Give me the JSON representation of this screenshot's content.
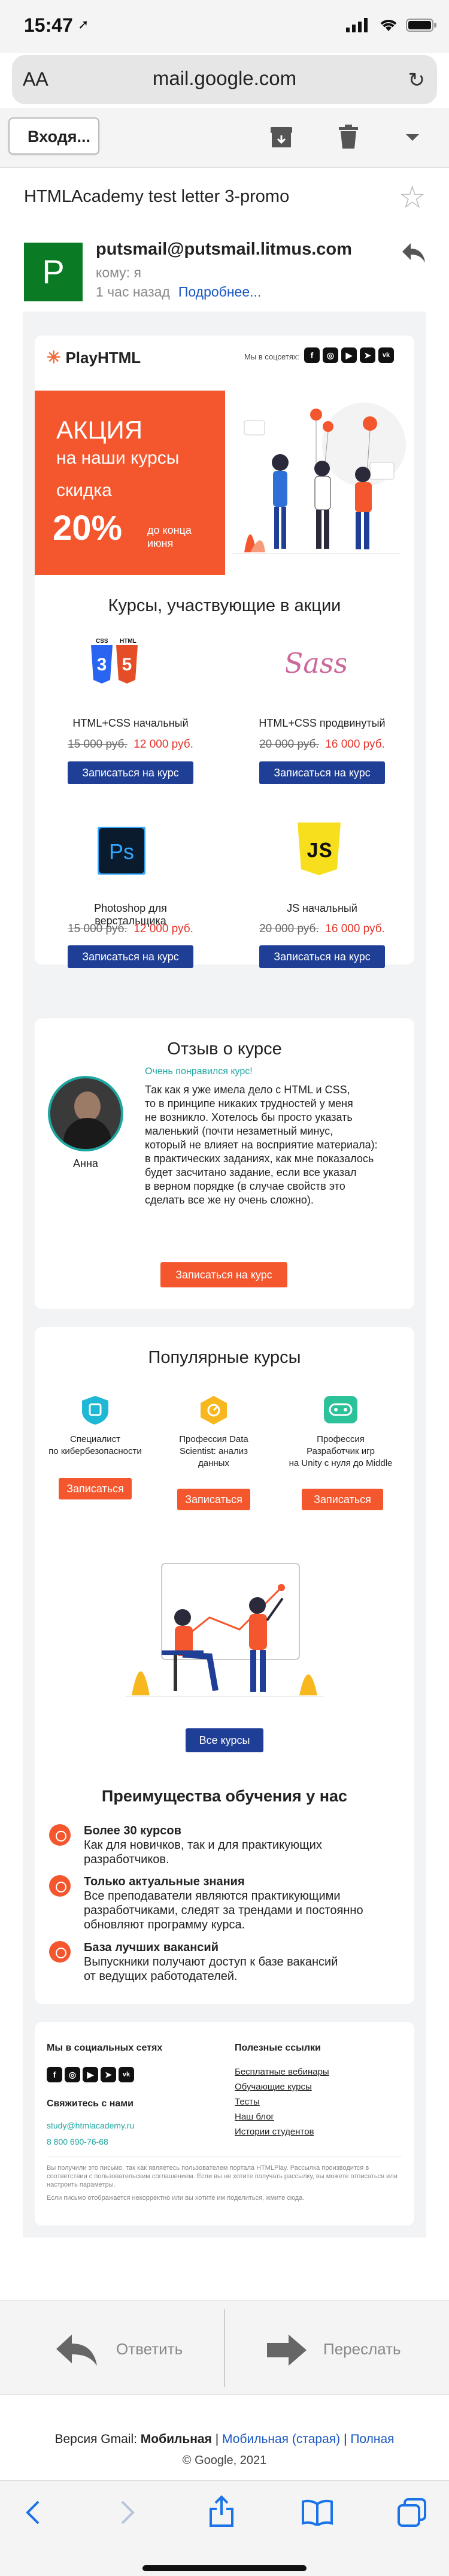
{
  "status_bar": {
    "time": "15:47",
    "location_arrow": "➚"
  },
  "browser": {
    "aa_label": "AA",
    "url": "mail.google.com"
  },
  "gmail": {
    "back_label": "Входя...",
    "subject": "HTMLAcademy test letter 3-promo",
    "sender_initial": "P",
    "sender_email": "putsmail@putsmail.litmus.com",
    "to_line": "кому: я",
    "time_ago": "1 час назад",
    "details_link": "Подробнее..."
  },
  "email": {
    "logo": "PlayHTML",
    "social_label": "Мы в соцсетях:",
    "promo": {
      "line1": "АКЦИЯ",
      "line2": "на наши курсы",
      "line3": "скидка",
      "discount": "20%",
      "until_line1": "до конца",
      "until_line2": "июня"
    },
    "courses_title": "Курсы, участвующие в акции",
    "courses": [
      {
        "name": "HTML+CSS начальный",
        "old": "15 000 руб.",
        "new": "12 000 руб.",
        "button": "Записаться на курс",
        "icon": "html-css-icon"
      },
      {
        "name": "HTML+CSS продвинутый",
        "old": "20 000 руб.",
        "new": "16 000 руб.",
        "button": "Записаться на курс",
        "icon": "sass-icon"
      },
      {
        "name": "Photoshop для верстальщика",
        "old": "15 000 руб.",
        "new": "12 000 руб.",
        "button": "Записаться на курс",
        "icon": "photoshop-icon"
      },
      {
        "name": "JS начальный",
        "old": "20 000 руб.",
        "new": "16 000 руб.",
        "button": "Записаться на курс",
        "icon": "js-icon"
      }
    ],
    "icon_labels": {
      "css": "CSS",
      "html": "HTML",
      "ps": "Ps",
      "js": "JS",
      "sass": "Sass"
    },
    "review": {
      "title": "Отзыв о курсе",
      "reviewer": "Анна",
      "tag": "Очень понравился курс!",
      "lines": [
        "Так как я уже имела дело с HTML и CSS,",
        "то в принципе никаких трудностей у меня",
        "не возникло. Хотелось бы просто указать",
        "маленький (почти незаметный минус,",
        "который не влияет на восприятие материала):",
        "в практических заданиях, как мне показалось",
        "будет засчитано задание, если все указал",
        "в верном порядке (в случае свойств это",
        "сделать все же ну очень сложно)."
      ],
      "button": "Записаться на курс"
    },
    "popular": {
      "title": "Популярные курсы",
      "items": [
        {
          "lines": [
            "Специалист",
            "по кибербезопасности"
          ],
          "button": "Записаться",
          "color": "#1eb7d4",
          "icon": "shield-icon"
        },
        {
          "lines": [
            "Профессия Data",
            "Scientist: анализ",
            "данных"
          ],
          "button": "Записаться",
          "color": "#f7b81f",
          "icon": "data-icon"
        },
        {
          "lines": [
            "Профессия",
            "Разработчик игр",
            "на Unity с нуля до Middle"
          ],
          "button": "Записаться",
          "color": "#2bc29a",
          "icon": "gamepad-icon"
        }
      ],
      "all_button": "Все курсы"
    },
    "advantages": {
      "title": "Преимущества обучения у нас",
      "items": [
        {
          "title": "Более 30 курсов",
          "lines": [
            "Как для новичков, так и для практикующих",
            "разработчиков."
          ]
        },
        {
          "title": "Только актуальные знания",
          "lines": [
            "Все преподаватели являются практикующими",
            "разработчиками, следят за трендами и постоянно",
            "обновляют программу курса."
          ]
        },
        {
          "title": "База лучших вакансий",
          "lines": [
            "Выпускники получают доступ к базе вакансий",
            "от ведущих работодателей."
          ]
        }
      ]
    },
    "footer": {
      "social_title": "Мы в социальных сетях",
      "contact_title": "Свяжитесь с нами",
      "email": "study@htmlacademy.ru",
      "phone": "8 800 690-76-68",
      "links_title": "Полезные ссылки",
      "links": [
        "Бесплатные вебинары",
        "Обучающие курсы",
        "Тесты",
        "Наш блог",
        "Истории студентов"
      ],
      "disclaimer1": "Вы получили это письмо, так как являетесь пользователем портала HTMLPlay. Рассылка производится в соответствии с пользовательским соглашением. Если вы не хотите получать рассылку, вы можете отписаться или настроить параметры.",
      "disclaimer2": "Если письмо отображается некорректно или вы хотите им поделиться, жмите сюда."
    }
  },
  "actions": {
    "reply": "Ответить",
    "forward": "Переслать"
  },
  "gmail_footer": {
    "version_prefix": "Версия Gmail:",
    "mobile": "Мобильная",
    "mobile_old": "Мобильная (старая)",
    "full": "Полная",
    "separator": "|",
    "copyright": "© Google, 2021"
  }
}
